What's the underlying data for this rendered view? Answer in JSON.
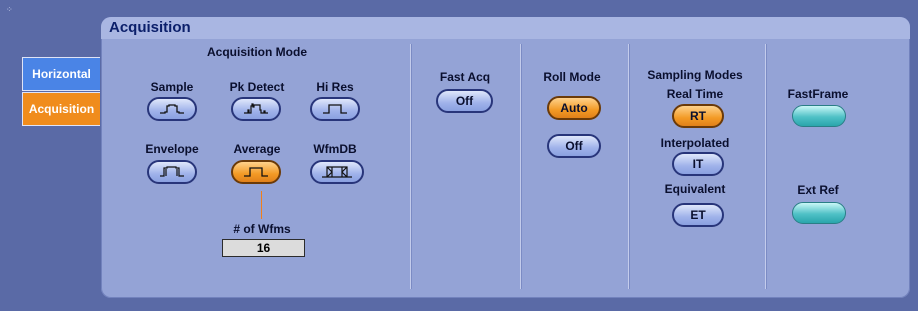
{
  "sidebar": {
    "tabs": [
      {
        "label": "Horizontal"
      },
      {
        "label": "Acquisition"
      }
    ]
  },
  "panel": {
    "title": "Acquisition"
  },
  "acquisition_mode": {
    "heading": "Acquisition Mode",
    "buttons": [
      {
        "label": "Sample",
        "icon": "sample-waveform-icon"
      },
      {
        "label": "Pk Detect",
        "icon": "peak-detect-waveform-icon"
      },
      {
        "label": "Hi Res",
        "icon": "hi-res-waveform-icon"
      },
      {
        "label": "Envelope",
        "icon": "envelope-waveform-icon"
      },
      {
        "label": "Average",
        "icon": "average-waveform-icon",
        "selected": true
      },
      {
        "label": "WfmDB",
        "icon": "wfmdb-waveform-icon"
      }
    ],
    "num_wfms_label": "# of Wfms",
    "num_wfms_value": "16"
  },
  "fast_acq": {
    "heading": "Fast Acq",
    "button": "Off"
  },
  "roll_mode": {
    "heading": "Roll Mode",
    "auto": "Auto",
    "off": "Off"
  },
  "sampling_modes": {
    "heading": "Sampling Modes",
    "real_time_label": "Real Time",
    "real_time_button": "RT",
    "interpolated_label": "Interpolated",
    "interpolated_button": "IT",
    "equivalent_label": "Equivalent",
    "equivalent_button": "ET"
  },
  "fastframe": {
    "heading": "FastFrame"
  },
  "ext_ref": {
    "heading": "Ext Ref"
  },
  "colors": {
    "background": "#5a6aa6",
    "panel": "#94a3d6",
    "selected_orange": "#f39a25",
    "button_blue": "#9fb2ea",
    "teal": "#4fc1c6"
  }
}
